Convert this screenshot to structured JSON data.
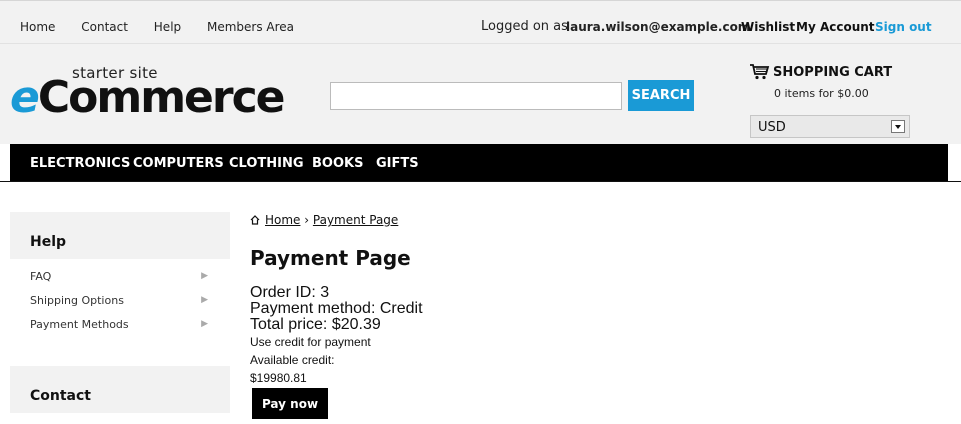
{
  "topbar": {
    "nav": [
      "Home",
      "Contact",
      "Help",
      "Members Area"
    ],
    "logged_label": "Logged on as",
    "email": "laura.wilson@example.com",
    "wishlist": "Wishlist",
    "my_account": "My Account",
    "sign_out": "Sign out"
  },
  "logo": {
    "tagline": "starter site",
    "e": "e",
    "rest": "Commerce"
  },
  "search": {
    "value": "",
    "placeholder": "",
    "button": "SEARCH"
  },
  "cart": {
    "icon": "shopping-cart-icon",
    "title": "SHOPPING CART",
    "summary": "0 items for $0.00"
  },
  "currency": {
    "selected": "USD"
  },
  "categories": [
    "ELECTRONICS",
    "COMPUTERS",
    "CLOTHING",
    "BOOKS",
    "GIFTS"
  ],
  "sidebar": {
    "help_title": "Help",
    "help_items": [
      "FAQ",
      "Shipping Options",
      "Payment Methods"
    ],
    "contact_title": "Contact"
  },
  "breadcrumb": {
    "icon": "home-icon",
    "home": "Home",
    "separator": "›",
    "current": "Payment Page"
  },
  "main": {
    "title": "Payment Page",
    "order_id": "Order ID: 3",
    "payment_method": "Payment method: Credit",
    "total_price": "Total price: $20.39",
    "use_credit": "Use credit for payment",
    "available_label": "Available credit:",
    "available_value": "$19980.81",
    "pay_button": "Pay now"
  },
  "colors": {
    "accent": "#1a9ad6",
    "category_bar": "#000000",
    "header_bg": "#f2f2f2"
  }
}
